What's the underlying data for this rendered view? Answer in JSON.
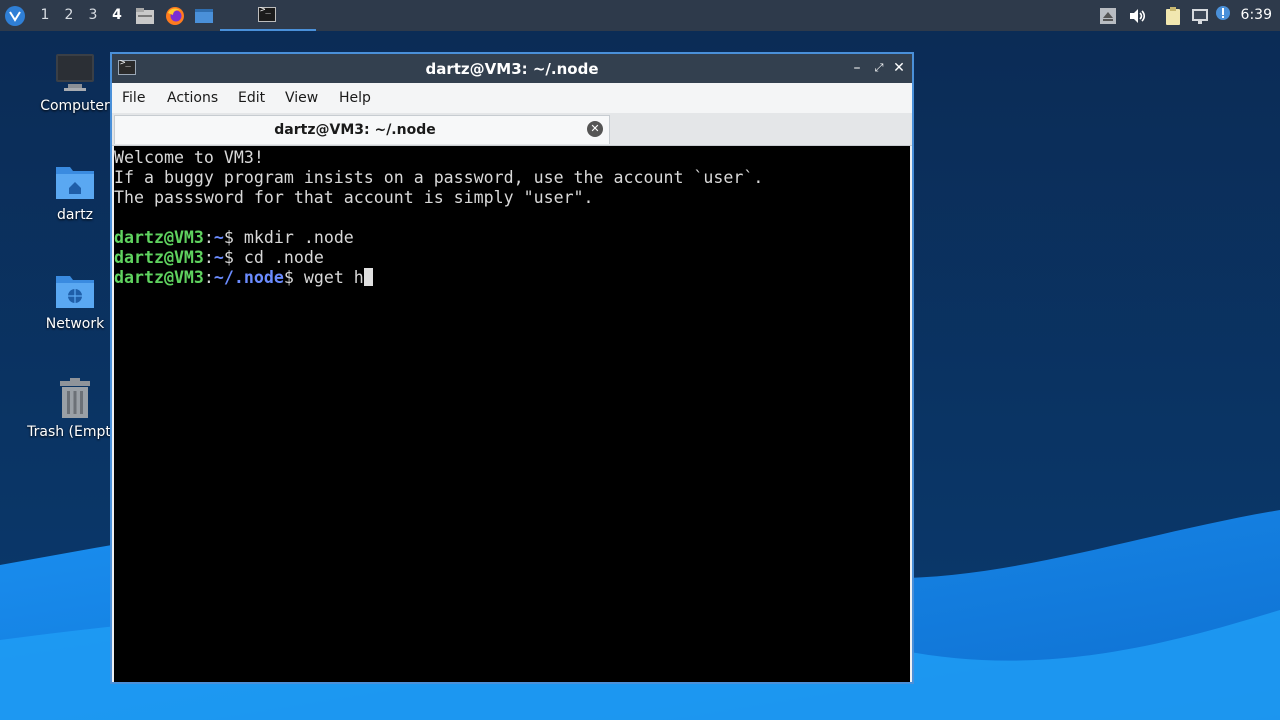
{
  "taskbar": {
    "workspaces": [
      "1",
      "2",
      "3",
      "4"
    ],
    "active_workspace": "4",
    "clock": "6:39",
    "apps": [
      "file-manager-icon",
      "firefox-icon",
      "desktop-icon"
    ],
    "task": "terminal-icon"
  },
  "desktop": {
    "icons": [
      {
        "label": "Computer",
        "icon": "computer-icon"
      },
      {
        "label": "dartz",
        "icon": "home-folder-icon"
      },
      {
        "label": "Network",
        "icon": "network-folder-icon"
      },
      {
        "label": "Trash (Empt",
        "icon": "trash-icon"
      }
    ]
  },
  "window": {
    "title": "dartz@VM3: ~/.node",
    "menu": [
      "File",
      "Actions",
      "Edit",
      "View",
      "Help"
    ],
    "tab_label": "dartz@VM3: ~/.node"
  },
  "terminal": {
    "motd": [
      "Welcome to VM3!",
      "If a buggy program insists on a password, use the account `user`.",
      "The passsword for that account is simply \"user\"."
    ],
    "commands": [
      {
        "user": "dartz@VM3",
        "sep": ":",
        "path": "~",
        "prompt": "$ ",
        "cmd": "mkdir .node"
      },
      {
        "user": "dartz@VM3",
        "sep": ":",
        "path": "~",
        "prompt": "$ ",
        "cmd": "cd .node"
      },
      {
        "user": "dartz@VM3",
        "sep": ":",
        "path": "~/.node",
        "prompt": "$ ",
        "cmd": "wget h"
      }
    ]
  },
  "colors": {
    "prompt_user": "#5fd35f",
    "prompt_path": "#6b8cff",
    "window_accent": "#4a90d9",
    "titlebar": "#33404f"
  }
}
